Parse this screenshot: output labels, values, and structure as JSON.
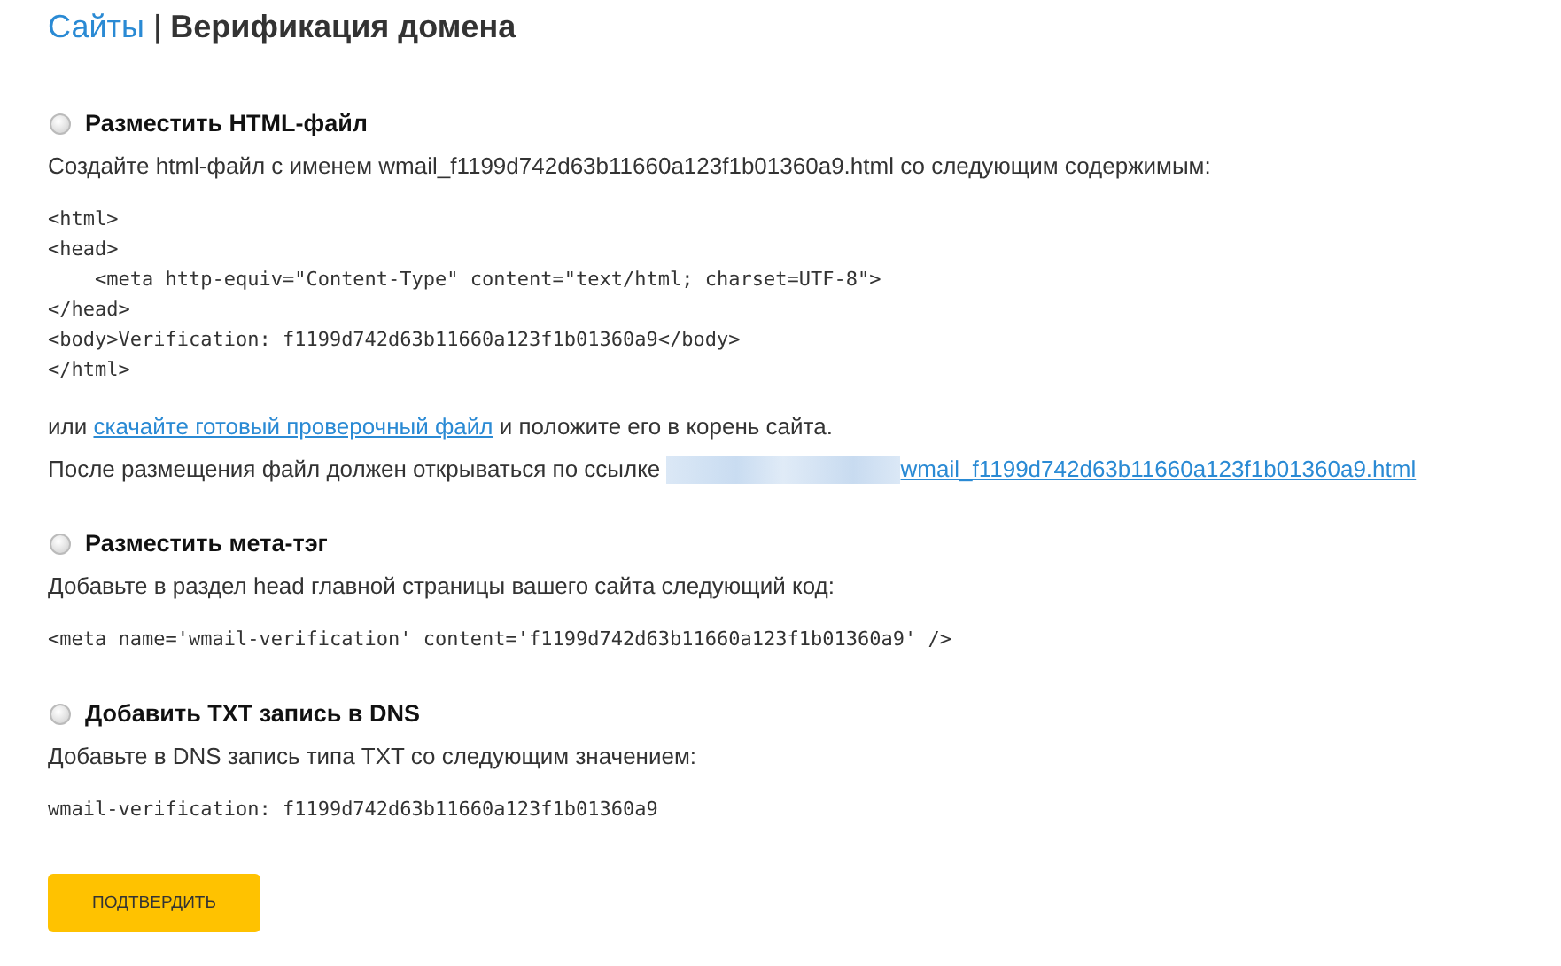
{
  "breadcrumb": {
    "link": "Сайты",
    "separator": "|",
    "title": "Верификация домена"
  },
  "methods": [
    {
      "title": "Разместить HTML-файл",
      "selected": false,
      "description": "Создайте html-файл с именем wmail_f1199d742d63b11660a123f1b01360a9.html со следующим содержимым:",
      "code": [
        "<html>",
        "<head>",
        "    <meta http-equiv=\"Content-Type\" content=\"text/html; charset=UTF-8\">",
        "</head>",
        "<body>Verification: f1199d742d63b11660a123f1b01360a9</body>",
        "</html>"
      ],
      "download": {
        "before": "или",
        "link": "скачайте готовый проверочный файл",
        "after": "и положите его в корень сайта."
      },
      "url_note": {
        "text": "После размещения файл должен открываться по ссылке",
        "link": "wmail_f1199d742d63b11660a123f1b01360a9.html"
      }
    },
    {
      "title": "Разместить мета-тэг",
      "selected": false,
      "description": "Добавьте в раздел head главной страницы вашего сайта следующий код:",
      "code": [
        "<meta name='wmail-verification' content='f1199d742d63b11660a123f1b01360a9' />"
      ]
    },
    {
      "title": "Добавить TXT запись в DNS",
      "selected": false,
      "description": "Добавьте в DNS запись типа TXT со следующим значением:",
      "code": [
        "wmail-verification: f1199d742d63b11660a123f1b01360a9"
      ]
    }
  ],
  "submit_button": "ПОДТВЕРДИТЬ"
}
